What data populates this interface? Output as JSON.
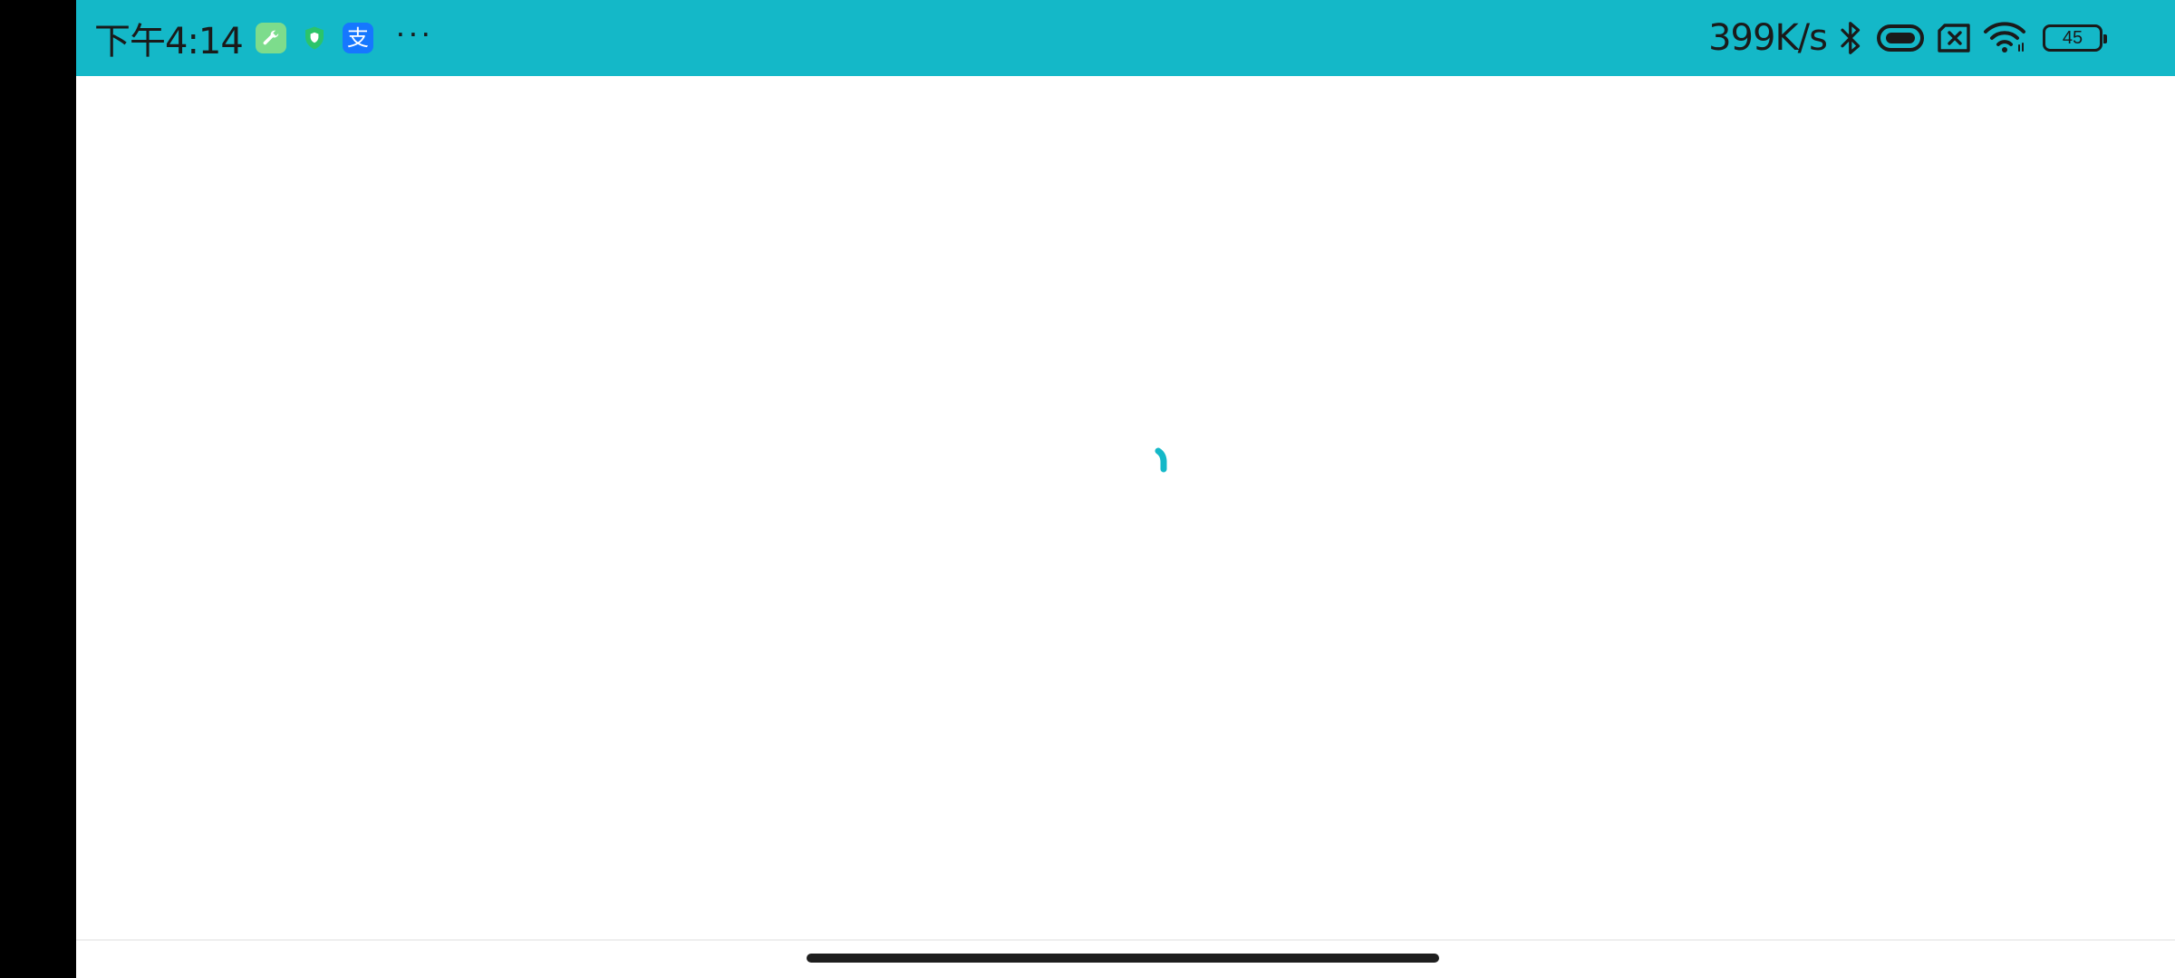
{
  "status_bar": {
    "time": "下午4:14",
    "network_speed": "399K/s",
    "battery_level": "45",
    "background_color": "#14b8c8",
    "notification_icons": [
      "wrench-app-icon",
      "shield-app-icon",
      "alipay-icon"
    ],
    "status_icons": [
      "bluetooth-icon",
      "link-icon",
      "no-sim-icon",
      "wifi-icon",
      "battery-icon"
    ],
    "more_label": "···"
  },
  "content": {
    "state": "loading",
    "accent_color": "#14b8c8"
  }
}
